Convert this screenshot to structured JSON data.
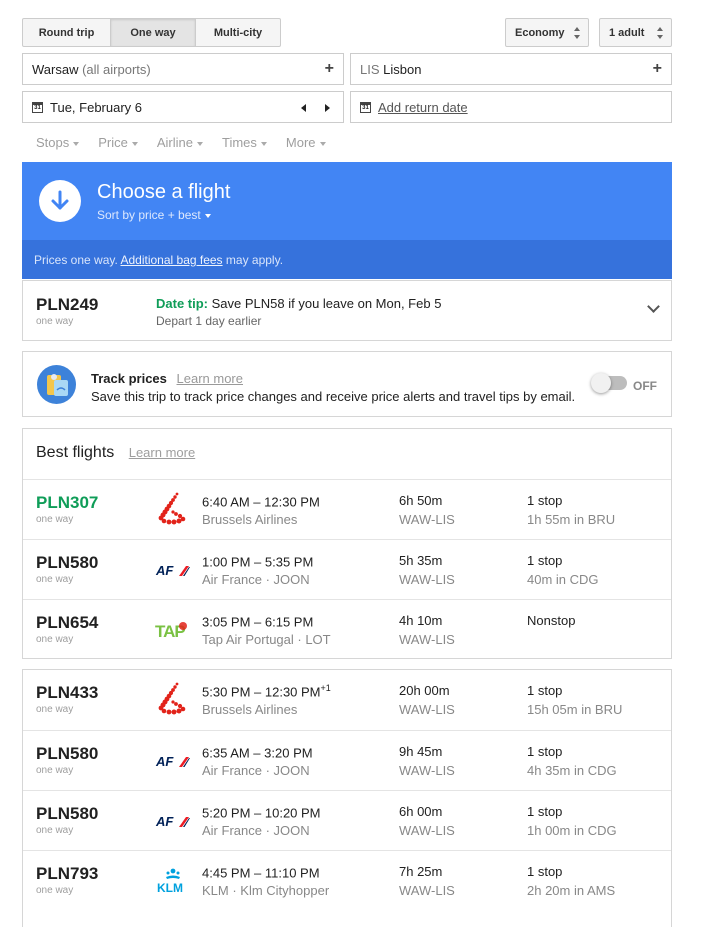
{
  "trip_type": {
    "round_trip": "Round trip",
    "one_way": "One way",
    "multi_city": "Multi-city"
  },
  "cabin_class": "Economy",
  "passengers": "1 adult",
  "origin": {
    "city": "Warsaw",
    "detail": "(all airports)"
  },
  "destination": {
    "code": "LIS",
    "city": "Lisbon"
  },
  "depart_date": "Tue, February 6",
  "return_date_link": "Add return date",
  "filters": [
    "Stops",
    "Price",
    "Airline",
    "Times",
    "More"
  ],
  "hero": {
    "title": "Choose a flight",
    "sort_label": "Sort by price + best",
    "notice_prefix": "Prices one way.",
    "notice_link": "Additional bag fees",
    "notice_suffix": "may apply."
  },
  "date_tip": {
    "price": "PLN249",
    "price_sub": "one way",
    "label": "Date tip:",
    "text": "Save PLN58 if you leave on Mon, Feb 5",
    "subtext": "Depart 1 day earlier"
  },
  "track": {
    "title": "Track prices",
    "learn_more": "Learn more",
    "description": "Save this trip to track price changes and receive price alerts and travel tips by email.",
    "state": "OFF"
  },
  "best": {
    "heading": "Best flights",
    "learn_more": "Learn more",
    "flights": [
      {
        "price": "PLN307",
        "price_color": "#0f9d58",
        "sub": "one way",
        "logo": "brussels-airlines-logo",
        "times": "6:40 AM – 12:30 PM",
        "plus_days": "",
        "airline": "Brussels Airlines",
        "duration": "6h 50m",
        "route": "WAW-LIS",
        "stops": "1 stop",
        "layover": "1h 55m in BRU"
      },
      {
        "price": "PLN580",
        "price_color": "#212121",
        "sub": "one way",
        "logo": "air-france-logo",
        "times": "1:00 PM – 5:35 PM",
        "plus_days": "",
        "airline": "Air France · JOON",
        "duration": "5h 35m",
        "route": "WAW-LIS",
        "stops": "1 stop",
        "layover": "40m in CDG"
      },
      {
        "price": "PLN654",
        "price_color": "#212121",
        "sub": "one way",
        "logo": "tap-portugal-logo",
        "times": "3:05 PM – 6:15 PM",
        "plus_days": "",
        "airline": "Tap Air Portugal · LOT",
        "duration": "4h 10m",
        "route": "WAW-LIS",
        "stops": "Nonstop",
        "layover": ""
      }
    ]
  },
  "other": {
    "flights": [
      {
        "price": "PLN433",
        "price_color": "#212121",
        "sub": "one way",
        "logo": "brussels-airlines-logo",
        "times": "5:30 PM – 12:30 PM",
        "plus_days": "+1",
        "airline": "Brussels Airlines",
        "duration": "20h 00m",
        "route": "WAW-LIS",
        "stops": "1 stop",
        "layover": "15h 05m in BRU"
      },
      {
        "price": "PLN580",
        "price_color": "#212121",
        "sub": "one way",
        "logo": "air-france-logo",
        "times": "6:35 AM – 3:20 PM",
        "plus_days": "",
        "airline": "Air France · JOON",
        "duration": "9h 45m",
        "route": "WAW-LIS",
        "stops": "1 stop",
        "layover": "4h 35m in CDG"
      },
      {
        "price": "PLN580",
        "price_color": "#212121",
        "sub": "one way",
        "logo": "air-france-logo",
        "times": "5:20 PM – 10:20 PM",
        "plus_days": "",
        "airline": "Air France · JOON",
        "duration": "6h 00m",
        "route": "WAW-LIS",
        "stops": "1 stop",
        "layover": "1h 00m in CDG"
      },
      {
        "price": "PLN793",
        "price_color": "#212121",
        "sub": "one way",
        "logo": "klm-logo",
        "times": "4:45 PM – 11:10 PM",
        "plus_days": "",
        "airline": "KLM · Klm Cityhopper",
        "duration": "7h 25m",
        "route": "WAW-LIS",
        "stops": "1 stop",
        "layover": "2h 20m in AMS"
      }
    ]
  },
  "logo_text": {
    "air_france": "AF",
    "tap": "TAP",
    "klm": "KLM"
  },
  "colors": {
    "accent": "#4285f4",
    "accent_dark": "#3672dc",
    "green": "#0f9d58",
    "air_france_red": "#ed1c24",
    "air_france_navy": "#002157",
    "brussels_red": "#e2231a",
    "klm_blue": "#00a1de",
    "tap_green": "#7ac143"
  }
}
